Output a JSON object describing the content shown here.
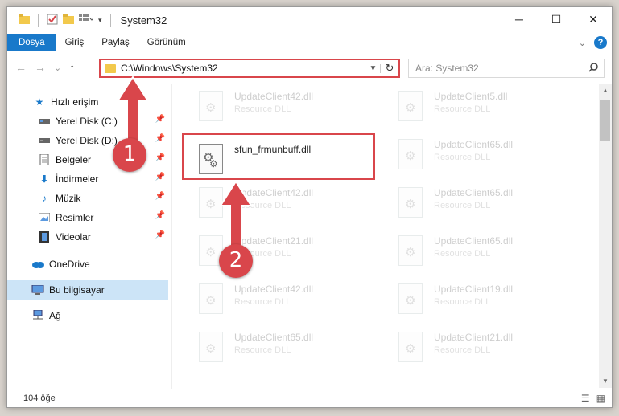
{
  "window": {
    "title": "System32",
    "controls": {
      "minimize": "─",
      "maximize": "☐",
      "close": "✕"
    }
  },
  "ribbon": {
    "tabs": [
      {
        "label": "Dosya",
        "active": true
      },
      {
        "label": "Giriş"
      },
      {
        "label": "Paylaş"
      },
      {
        "label": "Görünüm"
      }
    ],
    "expand_icon": "chevron-down-icon",
    "help": "?"
  },
  "nav": {
    "back": "←",
    "forward": "→",
    "recent": "⌄",
    "up": "↑",
    "address": "C:\\Windows\\System32",
    "refresh": "↻",
    "search_placeholder": "Ara: System32"
  },
  "sidebar": {
    "items": [
      {
        "label": "Hızlı erişim",
        "icon": "star-icon",
        "pinned": false
      },
      {
        "label": "Yerel Disk (C:)",
        "icon": "drive-icon",
        "pinned": true
      },
      {
        "label": "Yerel Disk (D:)",
        "icon": "drive-icon",
        "pinned": true
      },
      {
        "label": "Belgeler",
        "icon": "documents-icon",
        "pinned": true
      },
      {
        "label": "İndirmeler",
        "icon": "download-icon",
        "pinned": true
      },
      {
        "label": "Müzik",
        "icon": "music-icon",
        "pinned": true
      },
      {
        "label": "Resimler",
        "icon": "pictures-icon",
        "pinned": true
      },
      {
        "label": "Videolar",
        "icon": "video-icon",
        "pinned": true
      },
      {
        "label": "OneDrive",
        "icon": "cloud-icon",
        "pinned": false
      },
      {
        "label": "Bu bilgisayar",
        "icon": "computer-icon",
        "pinned": false,
        "selected": true
      },
      {
        "label": "Ağ",
        "icon": "network-icon",
        "pinned": false
      }
    ]
  },
  "files": [
    {
      "name": "UpdateClient42.dll",
      "type": "Resource DLL",
      "ghost": true
    },
    {
      "name": "UpdateClient5.dll",
      "type": "Resource DLL",
      "ghost": true
    },
    {
      "name": "sfun_frmunbuff.dll",
      "type": "",
      "ghost": false,
      "highlighted": true
    },
    {
      "name": "UpdateClient65.dll",
      "type": "Resource DLL",
      "ghost": true
    },
    {
      "name": "UpdateClient42.dll",
      "type": "Resource DLL",
      "ghost": true
    },
    {
      "name": "UpdateClient65.dll",
      "type": "Resource DLL",
      "ghost": true
    },
    {
      "name": "UpdateClient21.dll",
      "type": "Resource DLL",
      "ghost": true
    },
    {
      "name": "UpdateClient65.dll",
      "type": "Resource DLL",
      "ghost": true
    },
    {
      "name": "UpdateClient42.dll",
      "type": "Resource DLL",
      "ghost": true
    },
    {
      "name": "UpdateClient19.dll",
      "type": "Resource DLL",
      "ghost": true
    },
    {
      "name": "UpdateClient65.dll",
      "type": "Resource DLL",
      "ghost": true
    },
    {
      "name": "UpdateClient21.dll",
      "type": "Resource DLL",
      "ghost": true
    }
  ],
  "callouts": {
    "one": "1",
    "two": "2"
  },
  "status": {
    "count": "104 öğe"
  },
  "colors": {
    "accent": "#1979ca",
    "highlight": "#d9464b",
    "selection": "#cce4f7"
  }
}
